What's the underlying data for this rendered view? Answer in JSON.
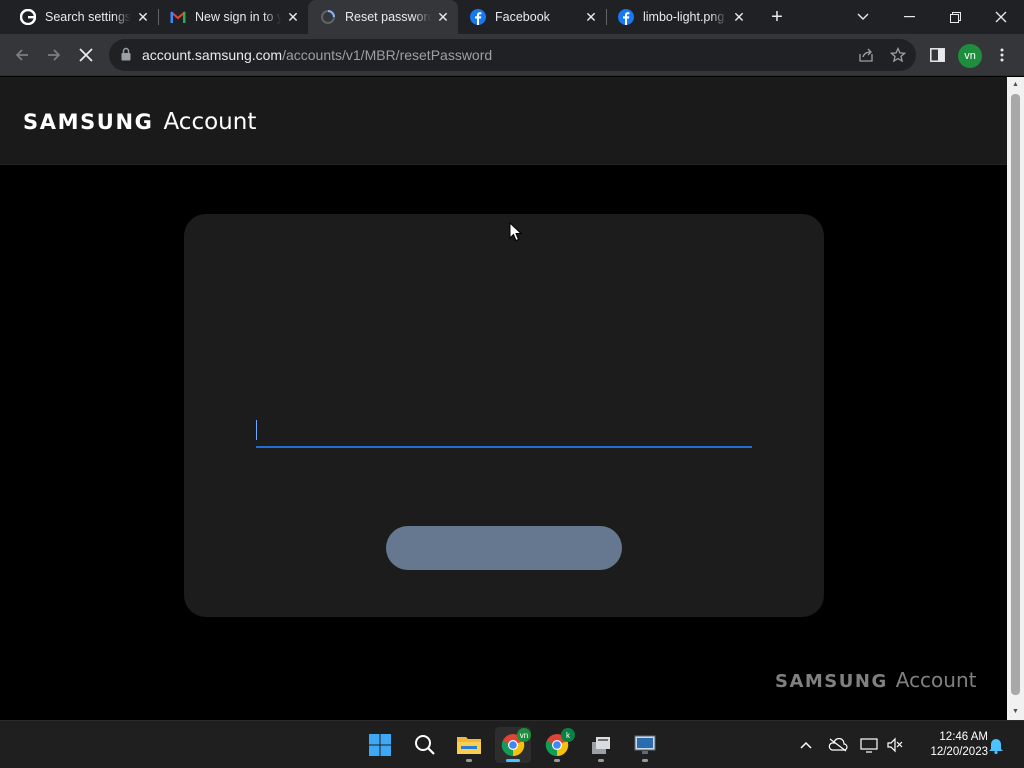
{
  "browser": {
    "tabs": [
      {
        "title": "Search settings",
        "icon": "google-icon",
        "active": false
      },
      {
        "title": "New sign in to your Samsung account",
        "icon": "gmail-icon",
        "active": false
      },
      {
        "title": "Reset password",
        "icon": "loading-icon",
        "active": true
      },
      {
        "title": "Facebook",
        "icon": "facebook-icon",
        "active": false
      },
      {
        "title": "limbo-light.png",
        "icon": "facebook-icon",
        "active": false
      }
    ],
    "url_host": "account.samsung.com",
    "url_path": "/accounts/v1/MBR/resetPassword",
    "profile_initials": "vn"
  },
  "page": {
    "brand": "SAMSUNG",
    "product": "Account",
    "password_field_value": "",
    "footer_brand": "SAMSUNG",
    "footer_product": "Account"
  },
  "taskbar": {
    "apps": [
      "start-icon",
      "search-icon",
      "file-explorer-icon",
      "chrome-icon",
      "chrome-icon",
      "app-icon",
      "remote-desktop-icon"
    ],
    "chrome_profile_badge_1": "vn",
    "chrome_profile_badge_2": "k",
    "time": "12:46 AM",
    "date": "12/20/2023"
  },
  "colors": {
    "accent_underline": "#1f6fd6",
    "button_disabled": "#66788f",
    "page_bg": "#000000",
    "card_bg": "#1c1c1c"
  }
}
